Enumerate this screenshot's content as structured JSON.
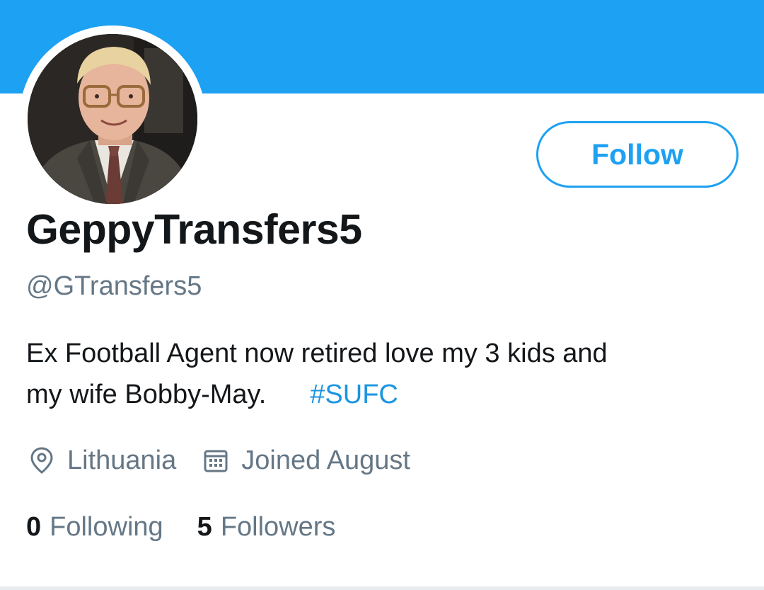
{
  "profile": {
    "display_name": "GeppyTransfers5",
    "handle": "@GTransfers5",
    "follow_label": "Follow",
    "bio": {
      "line1": "Ex Football Agent now retired love my 3 kids and",
      "line2_text": "my wife Bobby-May.",
      "hashtag": "#SUFC"
    },
    "location": "Lithuania",
    "joined": "Joined August",
    "following_count": "0",
    "following_label": "Following",
    "followers_count": "5",
    "followers_label": "Followers"
  },
  "icons": {
    "location": "map-pin-icon",
    "joined": "calendar-icon"
  },
  "colors": {
    "accent": "#1da1f2",
    "link": "#1b95e0",
    "text_primary": "#14171a",
    "text_secondary": "#657786"
  }
}
